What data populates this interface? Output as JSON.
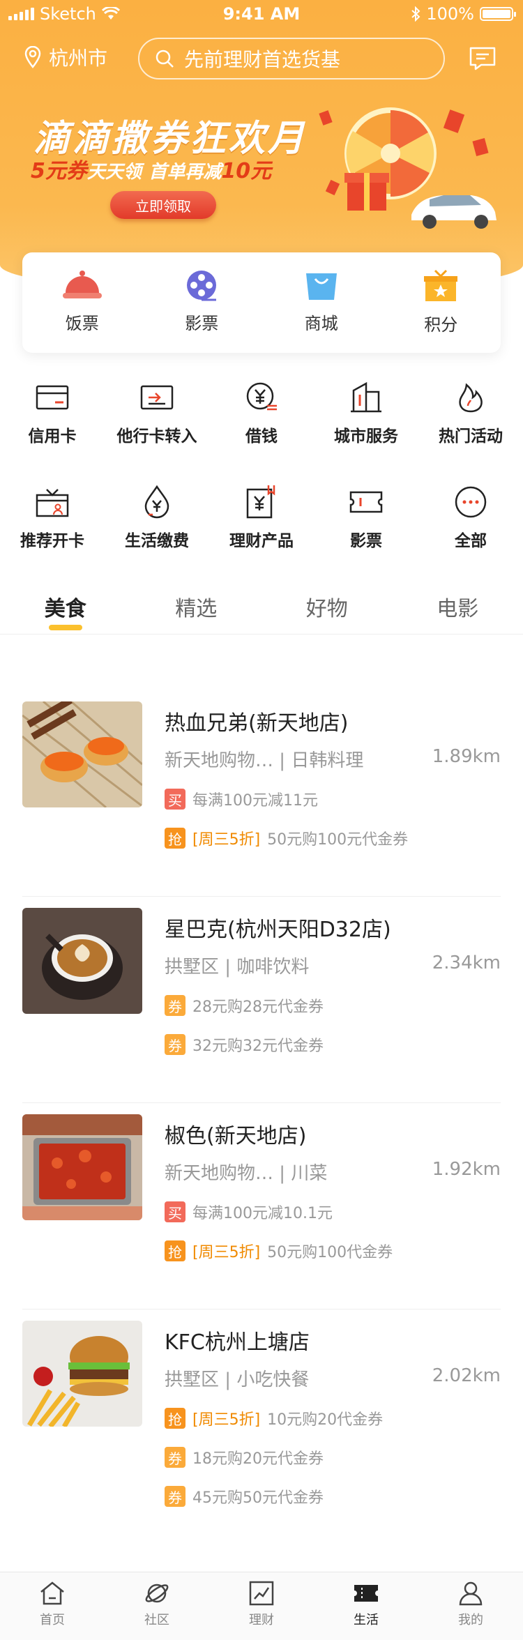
{
  "status_bar": {
    "carrier": "Sketch",
    "time": "9:41 AM",
    "battery": "100%",
    "battery_level": 1.0
  },
  "header": {
    "city": "杭州市",
    "search_placeholder": "先前理财首选货基"
  },
  "banner": {
    "title": "滴滴撒券狂欢月",
    "sub_part1": "5元券",
    "sub_part2": "天天领",
    "sub_part3": "首单再减",
    "sub_part4": "10元",
    "button_label": "立即领取"
  },
  "quick_entries": [
    {
      "label": "饭票",
      "icon": "cloche-icon"
    },
    {
      "label": "影票",
      "icon": "film-reel-icon"
    },
    {
      "label": "商城",
      "icon": "shopping-bag-icon"
    },
    {
      "label": "积分",
      "icon": "gift-box-icon"
    }
  ],
  "services": [
    {
      "label": "信用卡",
      "icon": "credit-card-icon"
    },
    {
      "label": "他行卡转入",
      "icon": "card-transfer-icon"
    },
    {
      "label": "借钱",
      "icon": "yen-coin-icon"
    },
    {
      "label": "城市服务",
      "icon": "city-buildings-icon"
    },
    {
      "label": "热门活动",
      "icon": "flame-icon"
    },
    {
      "label": "推荐开卡",
      "icon": "gift-card-icon"
    },
    {
      "label": "生活缴费",
      "icon": "water-drop-yen-icon"
    },
    {
      "label": "理财产品",
      "icon": "finance-doc-icon"
    },
    {
      "label": "影票",
      "icon": "ticket-icon"
    },
    {
      "label": "全部",
      "icon": "more-dots-icon"
    }
  ],
  "tabs": [
    {
      "label": "美食",
      "active": true
    },
    {
      "label": "精选",
      "active": false
    },
    {
      "label": "好物",
      "active": false
    },
    {
      "label": "电影",
      "active": false
    }
  ],
  "stores": [
    {
      "name": "热血兄弟(新天地店)",
      "location": "新天地购物…",
      "category": "日韩料理",
      "distance": "1.89km",
      "photo": "sushi",
      "deals": [
        {
          "tag": "买",
          "type": "buy",
          "highlight": "",
          "text": "每满100元减11元"
        },
        {
          "tag": "抢",
          "type": "grab",
          "highlight": "[周三5折]",
          "text": "50元购100元代金券"
        }
      ]
    },
    {
      "name": "星巴克(杭州天阳D32店)",
      "location": "拱墅区",
      "category": "咖啡饮料",
      "distance": "2.34km",
      "photo": "coffee",
      "deals": [
        {
          "tag": "券",
          "type": "coupon",
          "highlight": "",
          "text": "28元购28元代金券"
        },
        {
          "tag": "券",
          "type": "coupon",
          "highlight": "",
          "text": "32元购32元代金券"
        }
      ]
    },
    {
      "name": "椒色(新天地店)",
      "location": "新天地购物…",
      "category": "川菜",
      "distance": "1.92km",
      "photo": "hotpot",
      "deals": [
        {
          "tag": "买",
          "type": "buy",
          "highlight": "",
          "text": "每满100元减10.1元"
        },
        {
          "tag": "抢",
          "type": "grab",
          "highlight": "[周三5折]",
          "text": "50元购100代金券"
        }
      ]
    },
    {
      "name": "KFC杭州上塘店",
      "location": "拱墅区",
      "category": "小吃快餐",
      "distance": "2.02km",
      "photo": "burger",
      "deals": [
        {
          "tag": "抢",
          "type": "grab",
          "highlight": "[周三5折]",
          "text": "10元购20代金券"
        },
        {
          "tag": "券",
          "type": "coupon",
          "highlight": "",
          "text": "18元购20元代金券"
        },
        {
          "tag": "券",
          "type": "coupon",
          "highlight": "",
          "text": "45元购50元代金券"
        }
      ]
    }
  ],
  "bottom_nav": [
    {
      "label": "首页",
      "icon": "home-icon",
      "active": false
    },
    {
      "label": "社区",
      "icon": "planet-icon",
      "active": false
    },
    {
      "label": "理财",
      "icon": "chart-icon",
      "active": false
    },
    {
      "label": "生活",
      "icon": "ticket-life-icon",
      "active": true
    },
    {
      "label": "我的",
      "icon": "user-icon",
      "active": false
    }
  ],
  "colors": {
    "brand_orange": "#fbb042",
    "accent_red": "#e33c17",
    "tab_indicator": "#fbc02d"
  }
}
